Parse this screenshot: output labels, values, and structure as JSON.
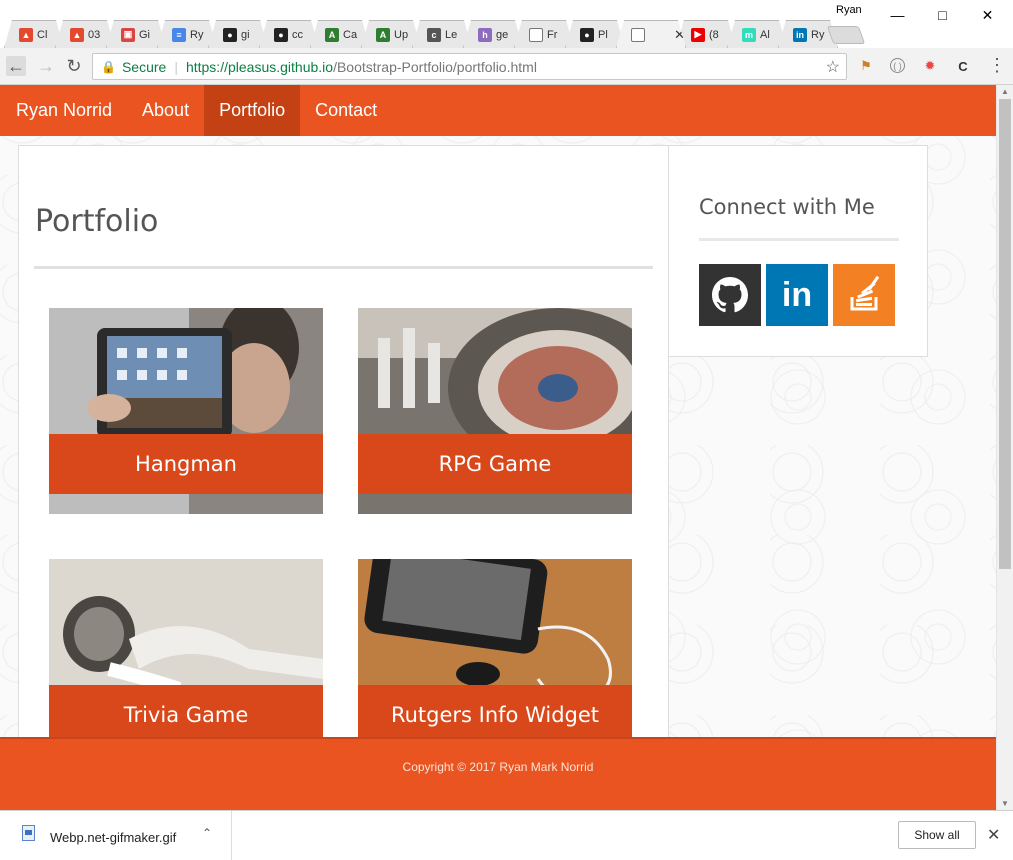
{
  "window": {
    "user": "Ryan",
    "tabs": [
      {
        "label": "Cl",
        "icon": "gitlab-icon",
        "color": "#e2492f"
      },
      {
        "label": "03",
        "icon": "gitlab-icon",
        "color": "#e2492f"
      },
      {
        "label": "Gi",
        "icon": "clapper-icon",
        "color": "#d44"
      },
      {
        "label": "Ry",
        "icon": "doc-icon",
        "color": "#4a86e8"
      },
      {
        "label": "gi",
        "icon": "github-icon",
        "color": "#222"
      },
      {
        "label": "cc",
        "icon": "github-icon",
        "color": "#222"
      },
      {
        "label": "Ca",
        "icon": "bracket-icon",
        "color": "#2e7d32"
      },
      {
        "label": "Up",
        "icon": "bracket-icon",
        "color": "#2e7d32"
      },
      {
        "label": "Le",
        "icon": "code-icon",
        "color": "#555"
      },
      {
        "label": "ge",
        "icon": "h-icon",
        "color": "#8e6bbf"
      },
      {
        "label": "Fr",
        "icon": "page-icon",
        "color": "#777"
      },
      {
        "label": "Pl",
        "icon": "github-icon",
        "color": "#222"
      },
      {
        "label": "",
        "icon": "page-icon",
        "color": "#777"
      },
      {
        "label": "(8",
        "icon": "youtube-icon",
        "color": "#e00"
      },
      {
        "label": "Al",
        "icon": "m-icon",
        "color": "#3db"
      },
      {
        "label": "Ry",
        "icon": "linkedin-icon",
        "color": "#0077b5"
      }
    ]
  },
  "toolbar": {
    "secure": "Secure",
    "url_scheme": "https://",
    "url_host": "pleasus.github.io",
    "url_path": "/Bootstrap-Portfolio/portfolio.html"
  },
  "nav": {
    "brand": "Ryan Norrid",
    "links": [
      "About",
      "Portfolio",
      "Contact"
    ],
    "active": "Portfolio"
  },
  "main": {
    "title": "Portfolio",
    "projects": [
      {
        "name": "Hangman"
      },
      {
        "name": "RPG Game"
      },
      {
        "name": "Trivia Game"
      },
      {
        "name": "Rutgers Info Widget"
      }
    ]
  },
  "sidebar": {
    "title": "Connect with Me",
    "social": [
      "github-icon",
      "linkedin-icon",
      "stackoverflow-icon"
    ],
    "linkedin_text": "in"
  },
  "footer": {
    "copyright": "Copyright © 2017 Ryan Mark Norrid"
  },
  "downloads": {
    "file": "Webp.net-gifmaker.gif",
    "show_all": "Show all"
  },
  "colors": {
    "brand": "#e95420",
    "nav_active": "#c34113",
    "caption": "#d9481b"
  }
}
